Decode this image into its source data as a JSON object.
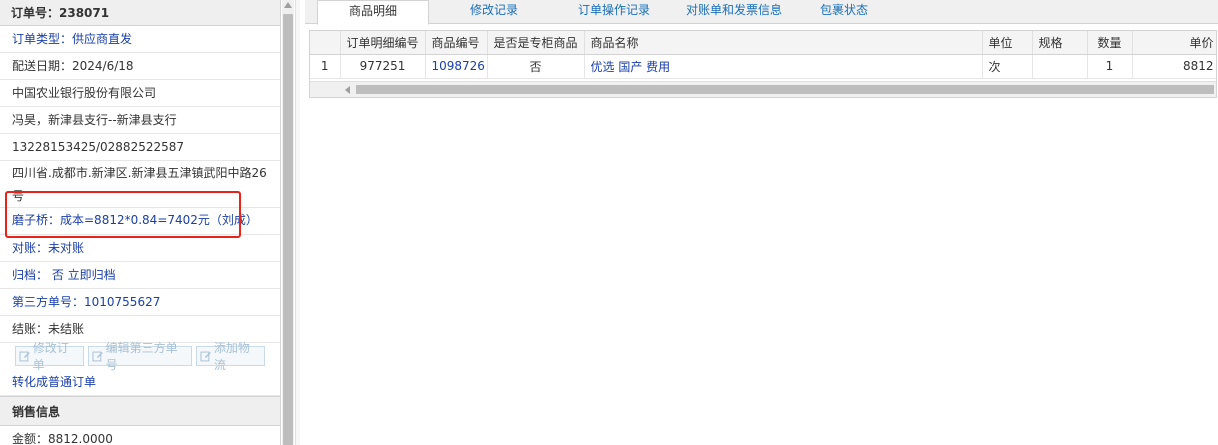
{
  "order": {
    "title": "订单号：238071",
    "type": "订单类型：供应商直发",
    "delivery_date": "配送日期：2024/6/18",
    "company": "中国农业银行股份有限公司",
    "contact": "冯昊，新津县支行--新津县支行",
    "phones": "13228153425/02882522587",
    "address": "四川省.成都市.新津区.新津县五津镇武阳中路26号",
    "note": "磨子桥：成本=8812*0.84=7402元（刘成）",
    "reconcile": "对账：未对账",
    "archive": "归档：  否 立即归档",
    "third_party_no": "第三方单号：1010755627",
    "settle": "结账：未结账",
    "buttons": {
      "edit": "修改订单",
      "edit_third": "编辑第三方单号",
      "add_logistics": "添加物流"
    },
    "convert": "转化成普通订单",
    "sales_section": "销售信息",
    "amount": "金额：8812.0000"
  },
  "tabs": [
    "商品明细",
    "修改记录",
    "订单操作记录",
    "对账单和发票信息",
    "包裹状态"
  ],
  "grid": {
    "columns": [
      "",
      "订单明细编号",
      "商品编号",
      "是否是专柜商品",
      "商品名称",
      "单位",
      "规格",
      "数量",
      "单价"
    ],
    "rows": [
      [
        "1",
        "977251",
        "1098726",
        "否",
        "优选 国产 费用",
        "次",
        "",
        "1",
        "8812"
      ]
    ]
  },
  "colors": {
    "link": "#1a3fa6",
    "tab_link": "#1a6fb8",
    "highlight": "#e8231c"
  }
}
